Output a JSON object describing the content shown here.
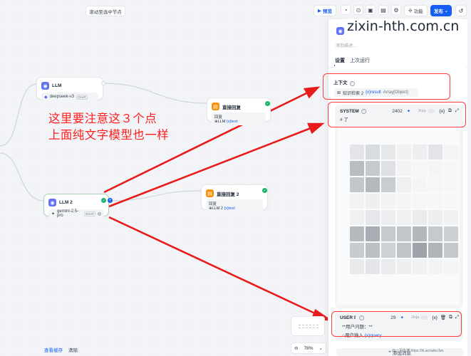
{
  "toolbar": {
    "scroll_to_selected": "滚动至选中节点",
    "preview_label": "预览",
    "features_label": "功能",
    "publish_label": "发布"
  },
  "nodes": {
    "llm1": {
      "title": "LLM",
      "model": "deepseek-v3",
      "mode_tag": "CHAT"
    },
    "llm2": {
      "title": "LLM 2",
      "model": "gemini-2.5-pro",
      "mode_tag": "CHAT"
    },
    "answer1": {
      "title": "直接回复",
      "body_label": "回复",
      "source": "LLM",
      "var": "{x}text"
    },
    "answer2": {
      "title": "直接回复 2",
      "body_label": "回复",
      "source": "LLM 2",
      "var": "{x}text"
    }
  },
  "annotation": {
    "line1": "这里要注意这３个点",
    "line2": "上面纯文字模型也一样",
    "color": "#ff1e1e"
  },
  "bottom": {
    "view_cache": "查看缓存",
    "clear": "清除"
  },
  "zoom": {
    "level": "78%"
  },
  "panel": {
    "description_placeholder": "添加描述...",
    "tabs": [
      "设置",
      "上次运行"
    ],
    "context": {
      "label": "上下文",
      "chip_source": "知识检索 2",
      "chip_var": "{x}result",
      "chip_type": "Array[Object]"
    },
    "system": {
      "role": "SYSTEM",
      "tokens": "2402",
      "jinja": "Jinja",
      "first_line": "# 了"
    },
    "user": {
      "role": "USER",
      "tokens": "29",
      "jinja": "Jinja",
      "line1": "**用户问题：**",
      "var_source": "用户输入",
      "var": "{x}query"
    },
    "add_message": "添加消息"
  },
  "watermarks": {
    "top": "zixin-hth.com.cn",
    "bottom": "@一月牛博 https://hi.acowbo.fun"
  },
  "colors": {
    "accent": "#155eef",
    "llm_icon": "#6172f3",
    "answer_icon": "#f79009",
    "success": "#17b26a",
    "annotation_red": "#ff1e1e"
  }
}
